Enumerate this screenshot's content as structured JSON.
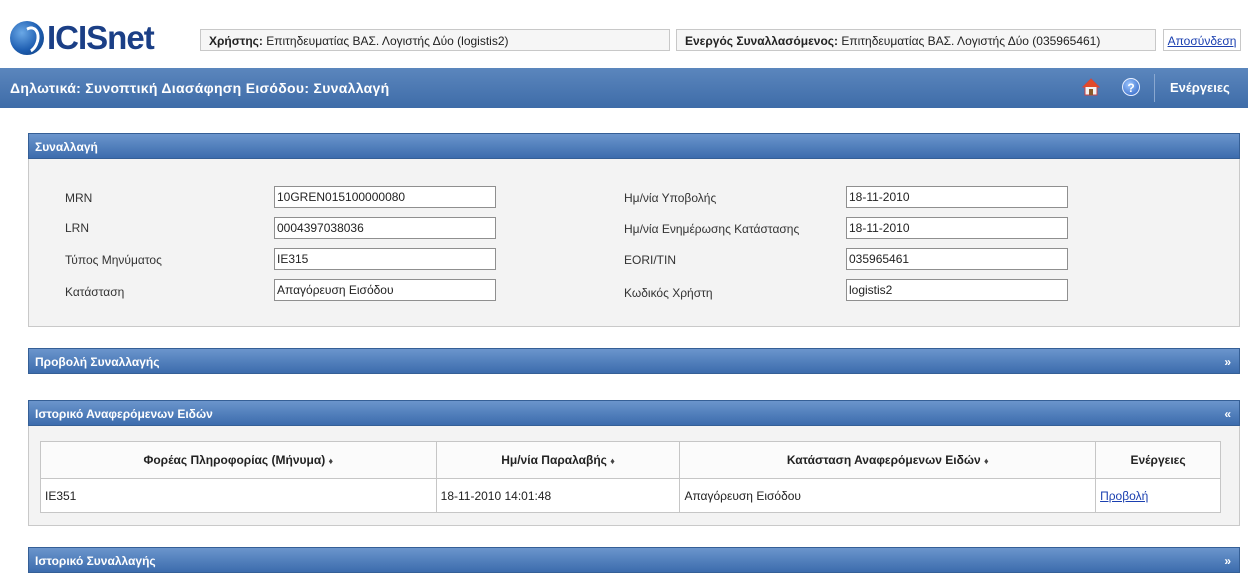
{
  "header": {
    "logo_text": "ICISnet",
    "user_label": "Χρήστης:",
    "user_value": "Επιτηδευματίας ΒΑΣ. Λογιστής Δύο (logistis2)",
    "trader_label": "Ενεργός Συναλλασόμενος:",
    "trader_value": "Επιτηδευματίας ΒΑΣ. Λογιστής Δύο (035965461)",
    "logout": "Αποσύνδεση"
  },
  "titlebar": {
    "title": "Δηλωτικά: Συνοπτική Διασάφηση Εισόδου: Συναλλαγή",
    "help_symbol": "?",
    "actions": "Ενέργειες"
  },
  "transaction_panel": {
    "title": "Συναλλαγή",
    "left_fields": [
      {
        "label": "MRN",
        "value": "10GREN015100000080"
      },
      {
        "label": "LRN",
        "value": "0004397038036"
      },
      {
        "label": "Τύπος Μηνύματος",
        "value": "IE315"
      },
      {
        "label": "Κατάσταση",
        "value": "Απαγόρευση Εισόδου"
      }
    ],
    "right_fields": [
      {
        "label": "Ημ/νία Υποβολής",
        "value": "18-11-2010"
      },
      {
        "label": "Ημ/νία Ενημέρωσης Κατάστασης",
        "value": "18-11-2010"
      },
      {
        "label": "EORI/TIN",
        "value": "035965461"
      },
      {
        "label": "Κωδικός Χρήστη",
        "value": "logistis2"
      }
    ]
  },
  "view_panel": {
    "title": "Προβολή Συναλλαγής",
    "toggle": "»"
  },
  "items_history_panel": {
    "title": "Ιστορικό Αναφερόμενων Ειδών",
    "toggle": "«",
    "columns": [
      "Φορέας Πληροφορίας (Μήνυμα)",
      "Ημ/νία Παραλαβής",
      "Κατάσταση Αναφερόμενων Ειδών",
      "Ενέργειες"
    ],
    "sort_glyph": "♦",
    "rows": [
      {
        "message": "IE351",
        "received": "18-11-2010 14:01:48",
        "status": "Απαγόρευση Εισόδου",
        "action": "Προβολή"
      }
    ]
  },
  "transaction_history_panel": {
    "title": "Ιστορικό Συναλλαγής",
    "toggle": "»"
  },
  "colors": {
    "header_blue": "#3e6ca8",
    "link": "#1a3fb0",
    "logo": "#1b3f86"
  }
}
